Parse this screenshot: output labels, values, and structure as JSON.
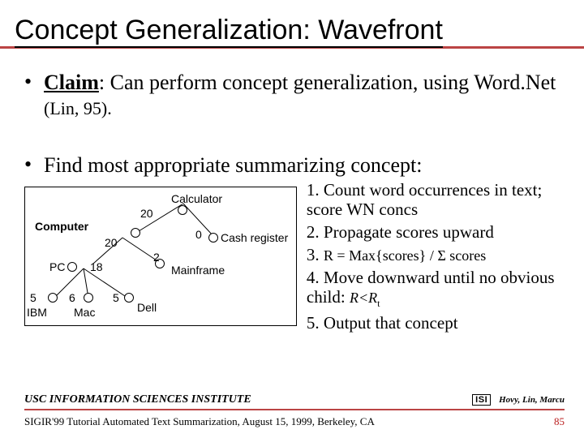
{
  "title": "Concept Generalization: Wavefront",
  "bullet1_label": "Claim",
  "bullet1_rest": ":  Can perform concept generalization, using Word.Net ",
  "bullet1_ref": "(Lin, 95).",
  "bullet2": "Find most appropriate summarizing concept:",
  "diagram": {
    "root_label": "Calculator",
    "root_score": "20",
    "mid_left_label": "Computer",
    "mid_left_score": "20",
    "mid_right_label": "Cash register",
    "mid_right_score": "0",
    "pc_label": "PC",
    "pc_score": "18",
    "mf_label": "Mainframe",
    "mf_score": "2",
    "ibm_label": "IBM",
    "ibm_score": "5",
    "mac_label": "Mac",
    "mac_score": "6",
    "dell_label": "Dell",
    "dell_score": "5"
  },
  "steps": {
    "s1": "1. Count word occurrences in text; score WN concs",
    "s2": "2. Propagate scores upward",
    "s3a": "3. ",
    "s3b": "R  =  Max{scores} / Σ scores",
    "s4a": "4. Move downward until no obvious child: ",
    "s4b": "R<R",
    "s4c": "t",
    "s5": "5. Output that concept"
  },
  "footer": {
    "institute": "USC INFORMATION SCIENCES INSTITUTE",
    "isi": "ISI",
    "authors": "Hovy, Lin, Marcu",
    "venue": "SIGIR'99 Tutorial Automated Text Summarization, August 15, 1999, Berkeley, CA",
    "page": "85"
  }
}
